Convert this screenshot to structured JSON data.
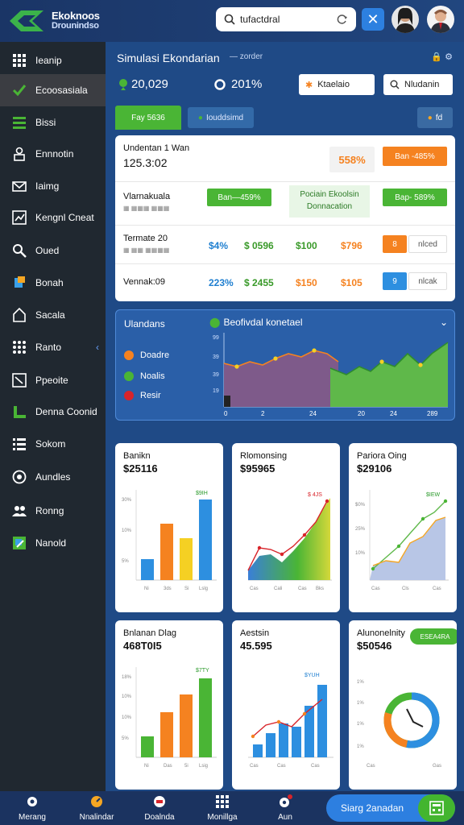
{
  "header": {
    "logo_line1": "Ekoknoos",
    "logo_line2": "Drounindso",
    "search_value": "tufactdral"
  },
  "sidebar": {
    "items": [
      {
        "label": "Ieanip",
        "icon": "grid-icon"
      },
      {
        "label": "Ecoosasiala",
        "icon": "check-icon"
      },
      {
        "label": "Bissi",
        "icon": "layers-icon"
      },
      {
        "label": "Ennnotin",
        "icon": "user-lock-icon"
      },
      {
        "label": "Iaimg",
        "icon": "envelope-icon"
      },
      {
        "label": "Kengnl Cneat",
        "icon": "chart-box-icon"
      },
      {
        "label": "Oued",
        "icon": "search-icon"
      },
      {
        "label": "Bonah",
        "icon": "paint-icon"
      },
      {
        "label": "Sacala",
        "icon": "home-icon"
      },
      {
        "label": "Ranto",
        "icon": "apps-icon"
      },
      {
        "label": "Ppeoite",
        "icon": "chart-up-icon"
      },
      {
        "label": "Denna Coonid",
        "icon": "bar-icon"
      },
      {
        "label": "Sokom",
        "icon": "list-icon"
      },
      {
        "label": "Aundles",
        "icon": "globe-icon"
      },
      {
        "label": "Ronng",
        "icon": "users-icon"
      },
      {
        "label": "Nanold",
        "icon": "app-icon"
      }
    ]
  },
  "main": {
    "title": "Simulasi Ekondarian",
    "subtitle": "— zorder",
    "top_icons": "🔒  ⚙",
    "stat1": "20,029",
    "stat2": "201%",
    "btn1": "Ktaelaio",
    "btn2": "Nludanin",
    "tab1": "Fay 5636",
    "tab2": "Iouddsimd",
    "tab3": "fd",
    "table": {
      "row1_label": "Undentan 1 Wan",
      "row1_value": "125.3:02",
      "row1_pct": "558%",
      "row1_pill": "Ban -485%",
      "row2_label": "Vlarnakuala",
      "row2_sub": "▦ ▦▦▦ ▦▦▦",
      "row2_pill1": "Ban—459%",
      "row2_mid1": "Pociain Ekoolsin",
      "row2_mid2": "Donnacation",
      "row2_pill2": "Bap- 589%",
      "row3_label": "Termate 20",
      "row3_sub": "▦ ▦▦ ▦▦▦▦",
      "row3_v1": "$4%",
      "row3_v2": "$ 0596",
      "row3_v3": "$100",
      "row3_v4": "$796",
      "row3_badge": "8",
      "row3_tag": "nlced",
      "row4_label": "Vennak:09",
      "row4_v1": "223%",
      "row4_v2": "$ 2455",
      "row4_v3": "$150",
      "row4_v4": "$105",
      "row4_badge": "9",
      "row4_tag": "nlcak"
    },
    "chart_panel": {
      "label": "Ulandans",
      "title": "Beofivdal konetael",
      "legend": [
        "Doadre",
        "Noalis",
        "Resir"
      ],
      "x_ticks": [
        "0",
        "2",
        "24",
        "20",
        "24",
        "289"
      ]
    },
    "cards": [
      {
        "title": "Banikn",
        "value": "$25116",
        "tag": "$9IH"
      },
      {
        "title": "Rlomonsing",
        "value": "$95965",
        "tag": "$ 4JS"
      },
      {
        "title": "Pariora Oing",
        "value": "$29106",
        "tag": "$IEW"
      },
      {
        "title": "Bnlanan Dlag",
        "value": "468T0I5",
        "tag": "$7TY"
      },
      {
        "title": "Aestsin",
        "value": "45.595",
        "tag": "$YUH"
      },
      {
        "title": "Alunonelnity",
        "value": "$50546",
        "tag": "ESEA4RA"
      }
    ]
  },
  "bottom": {
    "items": [
      "Merang",
      "Nnalindar",
      "Doalnda",
      "Monillga",
      "Aun"
    ],
    "cta": "Siarg 2anadan"
  },
  "colors": {
    "accent_green": "#4ab535",
    "accent_blue": "#2d80e0",
    "accent_orange": "#f58220"
  }
}
